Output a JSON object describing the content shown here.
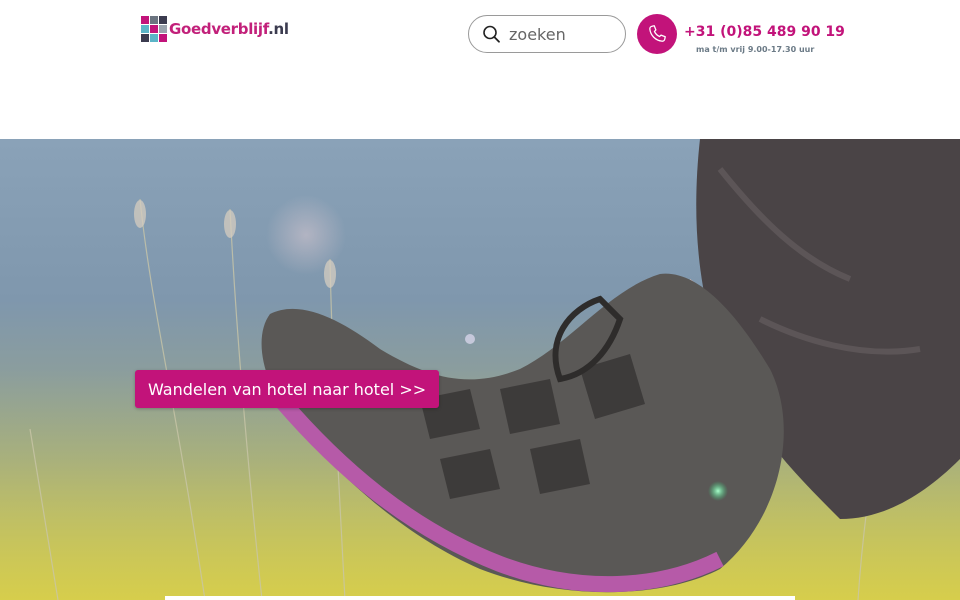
{
  "header": {
    "logo": {
      "text_part1": "Goed",
      "text_part2": "verblijf",
      "text_part3": ".nl"
    },
    "search": {
      "placeholder": "zoeken"
    },
    "contact": {
      "phone": "+31 (0)85 489 90 19",
      "hours": "ma t/m vrij 9.00-17.30 uur"
    }
  },
  "hero": {
    "cta_label": "Wandelen van hotel naar hotel >>"
  },
  "colors": {
    "brand": "#c2137a",
    "muted": "#6b7a86"
  },
  "icons": {
    "search": "search-icon",
    "phone": "phone-icon"
  }
}
